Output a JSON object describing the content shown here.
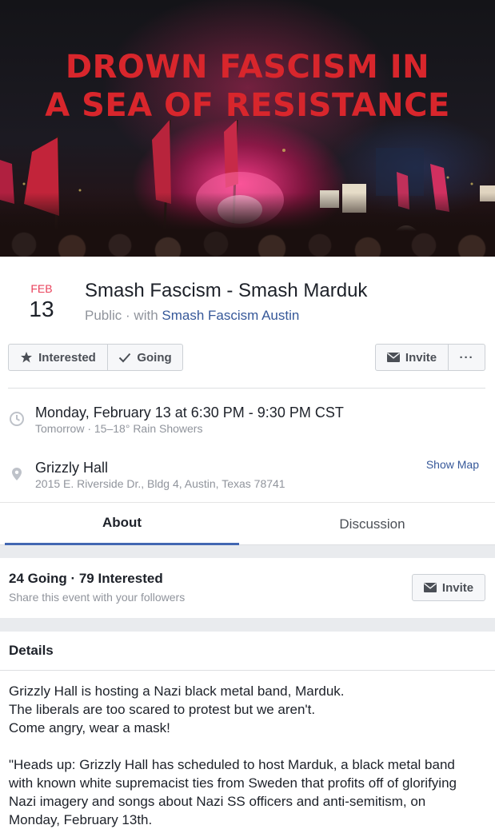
{
  "cover": {
    "line1": "DROWN FASCISM IN",
    "line2": "A SEA OF RESISTANCE",
    "accent": "#d8262c"
  },
  "event": {
    "month": "FEB",
    "day": "13",
    "title": "Smash Fascism - Smash Marduk",
    "privacy": "Public",
    "with_label": "with",
    "host": "Smash Fascism Austin"
  },
  "actions": {
    "interested_label": "Interested",
    "going_label": "Going",
    "invite_label": "Invite",
    "more_label": "···"
  },
  "time": {
    "main": "Monday, February 13 at 6:30 PM - 9:30 PM CST",
    "sub": "Tomorrow · 15–18° Rain Showers"
  },
  "location": {
    "name": "Grizzly Hall",
    "address": "2015 E. Riverside Dr., Bldg 4, Austin, Texas 78741",
    "map_link": "Show Map"
  },
  "tabs": [
    {
      "label": "About",
      "active": true
    },
    {
      "label": "Discussion",
      "active": false
    }
  ],
  "attendance": {
    "summary": "24 Going · 79 Interested",
    "share_text": "Share this event with your followers",
    "invite_label": "Invite"
  },
  "details": {
    "heading": "Details",
    "paragraph1": [
      "Grizzly Hall is hosting a Nazi black metal band, Marduk.",
      "The liberals are too scared to protest but we aren't.",
      "Come angry, wear a mask!"
    ],
    "paragraph2": [
      "\"Heads up: Grizzly Hall has scheduled to host Marduk, a black metal band",
      "with known white supremacist ties from Sweden that profits off of glorifying",
      "Nazi imagery and songs about Nazi SS officers and anti-semitism, on",
      "Monday, February 13th."
    ]
  },
  "colors": {
    "link": "#365899",
    "month": "#e9415b",
    "tab_underline": "#4267b2"
  }
}
